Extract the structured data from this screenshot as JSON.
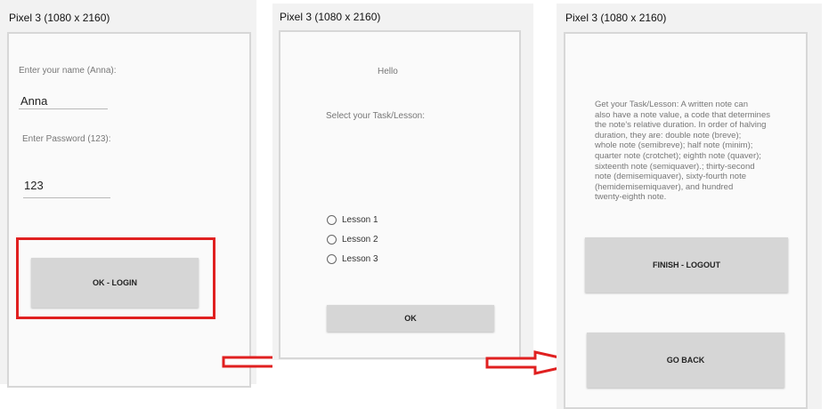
{
  "screens": [
    {
      "device_label": "Pixel 3 (1080 x 2160)",
      "name_label": "Enter your name (Anna):",
      "name_value": "Anna",
      "password_label": "Enter Password (123):",
      "password_value": "123",
      "login_button": "OK - LOGIN"
    },
    {
      "device_label": "Pixel 3 (1080 x 2160)",
      "greeting": "Hello",
      "select_label": "Select your Task/Lesson:",
      "lessons": [
        "Lesson 1",
        "Lesson 2",
        "Lesson 3"
      ],
      "ok_button": "OK"
    },
    {
      "device_label": "Pixel 3 (1080 x 2160)",
      "task_lines": [
        "Get your Task/Lesson:  A written note can",
        "also have a note value, a code that determines",
        "the note's relative duration. In order of halving",
        "duration, they are: double note (breve);",
        "whole note (semibreve); half note (minim);",
        "quarter note (crotchet); eighth note (quaver);",
        "sixteenth note (semiquaver).; thirty-second",
        "note (demisemiquaver), sixty-fourth note",
        "(hemidemisemiquaver), and hundred",
        "twenty-eighth note."
      ],
      "finish_button": "FINISH - LOGOUT",
      "back_button": "GO BACK"
    }
  ],
  "colors": {
    "highlight": "#e02020",
    "arrow": "#e02020",
    "button_bg": "#d6d6d6"
  }
}
